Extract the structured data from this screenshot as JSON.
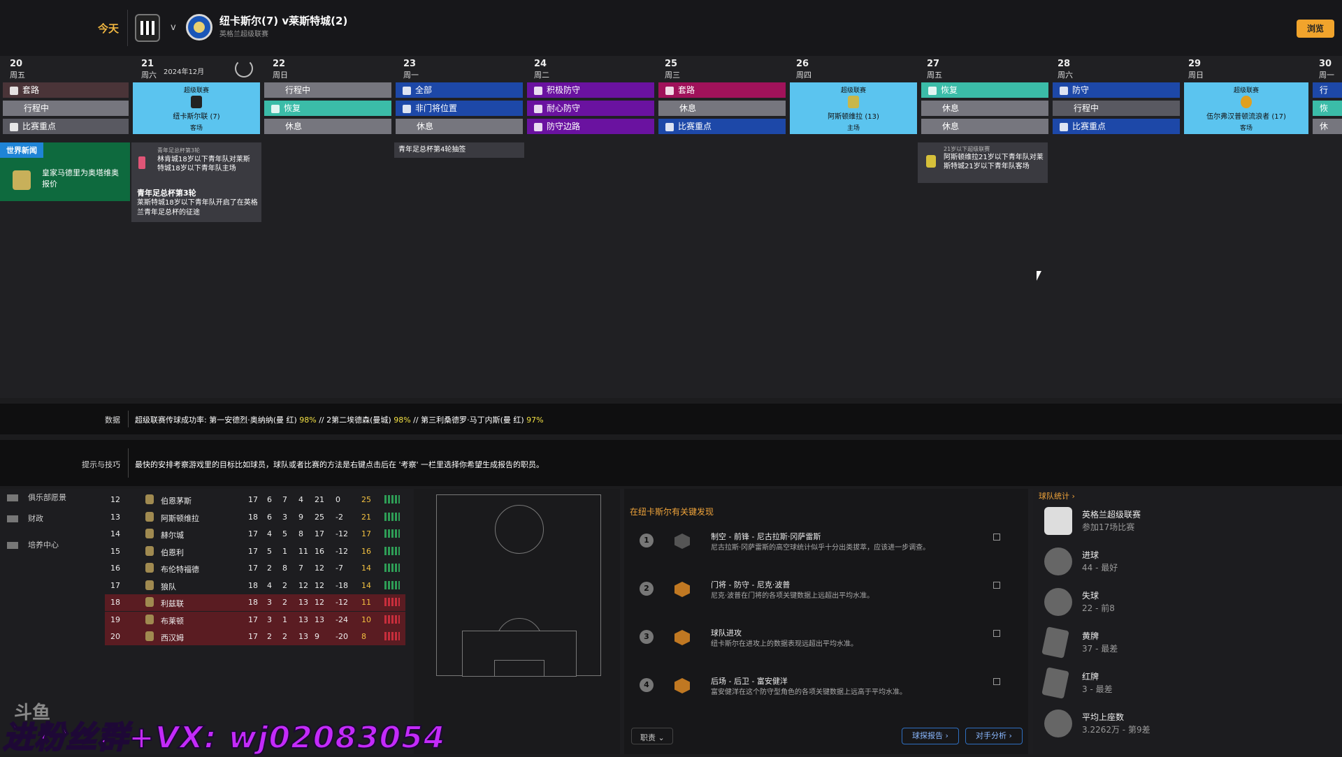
{
  "header": {
    "today_label": "今天",
    "vs": "v",
    "match_title": "纽卡斯尔(7) v莱斯特城(2)",
    "match_sub": "英格兰超级联赛",
    "continue_label": "浏览",
    "accent_color": "#f1a42c"
  },
  "calendar": {
    "month_label": "2024年12月",
    "days": [
      {
        "num": "20",
        "name": "周五"
      },
      {
        "num": "21",
        "name": "周六"
      },
      {
        "num": "22",
        "name": "周日"
      },
      {
        "num": "23",
        "name": "周一"
      },
      {
        "num": "24",
        "name": "周二"
      },
      {
        "num": "25",
        "name": "周三"
      },
      {
        "num": "26",
        "name": "周四"
      },
      {
        "num": "27",
        "name": "周五"
      },
      {
        "num": "28",
        "name": "周六"
      },
      {
        "num": "29",
        "name": "周日"
      },
      {
        "num": "30",
        "name": "周一"
      }
    ],
    "sessions": {
      "d20": [
        "套路",
        "行程中",
        "比赛重点"
      ],
      "d22": [
        "行程中",
        "恢复",
        "休息"
      ],
      "d23": [
        "全部",
        "非门将位置",
        "休息"
      ],
      "d24": [
        "积极防守",
        "耐心防守",
        "防守边路"
      ],
      "d25": [
        "套路",
        "休息",
        "比赛重点"
      ],
      "d27": [
        "恢复",
        "休息",
        "休息"
      ],
      "d28": [
        "防守",
        "行程中",
        "比赛重点"
      ],
      "d30": [
        "行",
        "恢",
        "休"
      ]
    },
    "matches": {
      "d21": {
        "comp": "超级联赛",
        "opp": "纽卡斯尔联 (7)",
        "venue": "客场"
      },
      "d26": {
        "comp": "超级联赛",
        "opp": "阿斯顿维拉 (13)",
        "venue": "主场"
      },
      "d29": {
        "comp": "超级联赛",
        "opp": "伍尔弗汉普顿流浪者 (17)",
        "venue": "客场"
      }
    },
    "news": {
      "tag": "世界新闻",
      "text": "皇家马德里为奥塔维奥报价"
    },
    "event1": {
      "small": "青年足总杯第3轮",
      "body": "林肯城18岁以下青年队对莱斯特城18岁以下青年队主场",
      "title": "青年足总杯第3轮",
      "desc": "莱斯特城18岁以下青年队开启了在英格兰青年足总杯的征途"
    },
    "event2": "青年足总杯第4轮抽签",
    "event3": {
      "small": "21岁以下超级联赛",
      "body": "阿斯顿维拉21岁以下青年队对莱斯特城21岁以下青年队客场"
    }
  },
  "info": {
    "data_label": "数据",
    "data_text_1": "超级联赛传球成功率: 第一安德烈·奥纳纳(曼 红) ",
    "data_pct_1": "98%",
    "data_text_2": " // 2第二埃德森(曼城) ",
    "data_pct_2": "98%",
    "data_text_3": " // 第三利桑德罗·马丁内斯(曼 红) ",
    "data_pct_3": "97%",
    "tips_label": "提示与技巧",
    "tips_text": "最快的安排考察游戏里的目标比如球员，球队或者比赛的方法是右键点击后在 '考察' 一栏里选择你希望生成报告的职员。"
  },
  "sidebar": {
    "items": [
      "俱乐部愿景",
      "财政",
      "培养中心"
    ]
  },
  "league_table": [
    {
      "pos": "12",
      "team": "伯恩茅斯",
      "p": "17",
      "w": "6",
      "d": "7",
      "l": "4",
      "gf": "21",
      "gd": "0",
      "pts": "25",
      "rel": false
    },
    {
      "pos": "13",
      "team": "阿斯顿维拉",
      "p": "18",
      "w": "6",
      "d": "3",
      "l": "9",
      "gf": "25",
      "gd": "-2",
      "pts": "21",
      "rel": false
    },
    {
      "pos": "14",
      "team": "赫尔城",
      "p": "17",
      "w": "4",
      "d": "5",
      "l": "8",
      "gf": "17",
      "gd": "-12",
      "pts": "17",
      "rel": false
    },
    {
      "pos": "15",
      "team": "伯恩利",
      "p": "17",
      "w": "5",
      "d": "1",
      "l": "11",
      "gf": "16",
      "gd": "-12",
      "pts": "16",
      "rel": false
    },
    {
      "pos": "16",
      "team": "布伦特福德",
      "p": "17",
      "w": "2",
      "d": "8",
      "l": "7",
      "gf": "12",
      "gd": "-7",
      "pts": "14",
      "rel": false
    },
    {
      "pos": "17",
      "team": "狼队",
      "p": "18",
      "w": "4",
      "d": "2",
      "l": "12",
      "gf": "12",
      "gd": "-18",
      "pts": "14",
      "rel": false
    },
    {
      "pos": "18",
      "team": "利兹联",
      "p": "18",
      "w": "3",
      "d": "2",
      "l": "13",
      "gf": "12",
      "gd": "-12",
      "pts": "11",
      "rel": true
    },
    {
      "pos": "19",
      "team": "布莱顿",
      "p": "17",
      "w": "3",
      "d": "1",
      "l": "13",
      "gf": "13",
      "gd": "-24",
      "pts": "10",
      "rel": true
    },
    {
      "pos": "20",
      "team": "西汉姆",
      "p": "17",
      "w": "2",
      "d": "2",
      "l": "13",
      "gf": "9",
      "gd": "-20",
      "pts": "8",
      "rel": true
    }
  ],
  "findings": {
    "title": "在纽卡斯尔有关键发现",
    "items": [
      {
        "num": "1",
        "title": "制空 - 前锋 - 尼古拉斯·冈萨雷斯",
        "desc": "尼古拉斯·冈萨雷斯的高空球统计似乎十分出类拔萃，应该进一步调查。"
      },
      {
        "num": "2",
        "title": "门将 - 防守 - 尼克·波普",
        "desc": "尼克·波普在门将的各项关键数据上远超出平均水准。"
      },
      {
        "num": "3",
        "title": "球队进攻",
        "desc": "纽卡斯尔在进攻上的数据表现远超出平均水准。"
      },
      {
        "num": "4",
        "title": "后场 - 后卫 - 富安健洋",
        "desc": "富安健洋在这个防守型角色的各项关键数据上远高于平均水准。"
      }
    ],
    "dropdown": "职责",
    "scout_btn": "球探报告",
    "opp_btn": "对手分析"
  },
  "team_stats": {
    "title": "球队统计",
    "items": [
      {
        "l1": "英格兰超级联赛",
        "l2": "参加17场比赛"
      },
      {
        "l1": "进球",
        "l2": "44 - 最好"
      },
      {
        "l1": "失球",
        "l2": "22 - 前8"
      },
      {
        "l1": "黄牌",
        "l2": "37 - 最差"
      },
      {
        "l1": "红牌",
        "l2": "3 - 最差"
      },
      {
        "l1": "平均上座数",
        "l2": "3.2262万 - 第9差"
      }
    ]
  },
  "overlay": {
    "watermark": "进粉丝群+VX: wj02083054",
    "brand": "斗鱼"
  }
}
